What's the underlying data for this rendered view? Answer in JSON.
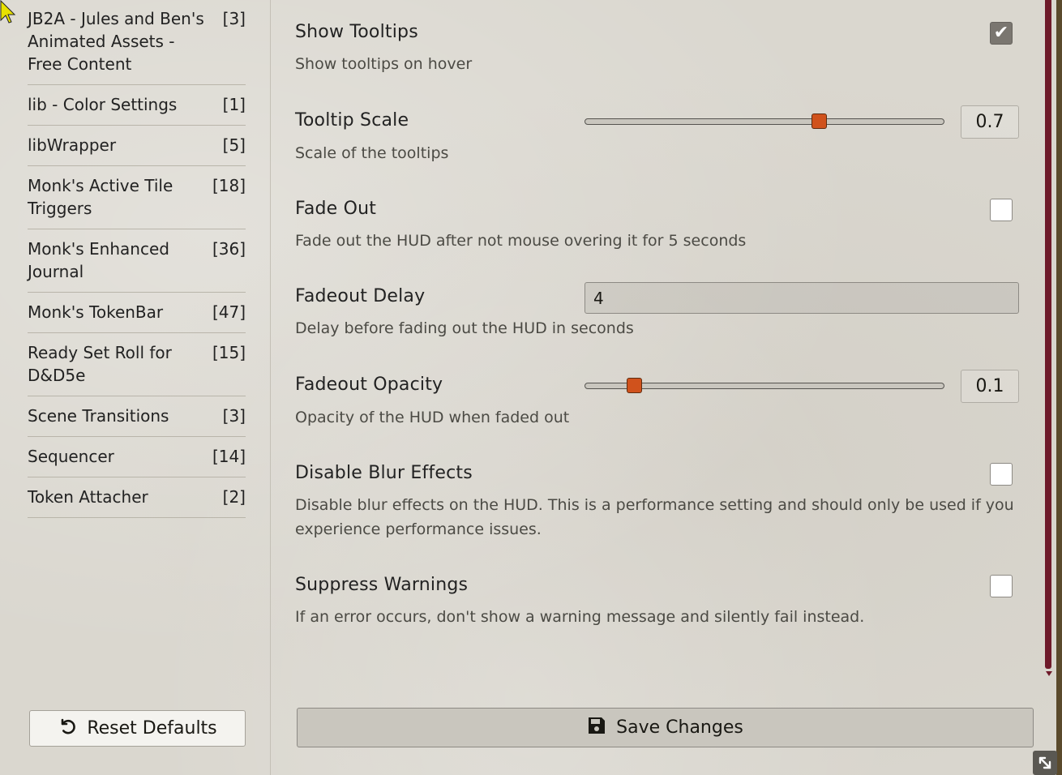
{
  "sidebar": {
    "modules": [
      {
        "name": "JB2A - Jules and Ben's Animated Assets - Free Content",
        "count": "[3]"
      },
      {
        "name": "lib - Color Settings",
        "count": "[1]"
      },
      {
        "name": "libWrapper",
        "count": "[5]"
      },
      {
        "name": "Monk's Active Tile Triggers",
        "count": "[18]"
      },
      {
        "name": "Monk's Enhanced Journal",
        "count": "[36]"
      },
      {
        "name": "Monk's TokenBar",
        "count": "[47]"
      },
      {
        "name": "Ready Set Roll for D&D5e",
        "count": "[15]"
      },
      {
        "name": "Scene Transitions",
        "count": "[3]"
      },
      {
        "name": "Sequencer",
        "count": "[14]"
      },
      {
        "name": "Token Attacher",
        "count": "[2]"
      }
    ],
    "reset_label": "Reset Defaults"
  },
  "settings": {
    "show_tooltips": {
      "label": "Show Tooltips",
      "hint": "Show tooltips on hover",
      "checked": true
    },
    "tooltip_scale": {
      "label": "Tooltip Scale",
      "hint": "Scale of the tooltips",
      "value": "0.7",
      "fraction": 0.66
    },
    "fade_out": {
      "label": "Fade Out",
      "hint": "Fade out the HUD after not mouse overing it for 5 seconds",
      "checked": false
    },
    "fadeout_delay": {
      "label": "Fadeout Delay",
      "hint": "Delay before fading out the HUD in seconds",
      "value": "4"
    },
    "fadeout_opacity": {
      "label": "Fadeout Opacity",
      "hint": "Opacity of the HUD when faded out",
      "value": "0.1",
      "fraction": 0.12
    },
    "disable_blur": {
      "label": "Disable Blur Effects",
      "hint": "Disable blur effects on the HUD. This is a performance setting and should only be used if you experience performance issues.",
      "checked": false
    },
    "suppress_warnings": {
      "label": "Suppress Warnings",
      "hint": "If an error occurs, don't show a warning message and silently fail instead.",
      "checked": false
    }
  },
  "footer": {
    "save_label": "Save Changes"
  },
  "colors": {
    "accent": "#d0521c",
    "scrollbar": "#6e1a2a"
  }
}
